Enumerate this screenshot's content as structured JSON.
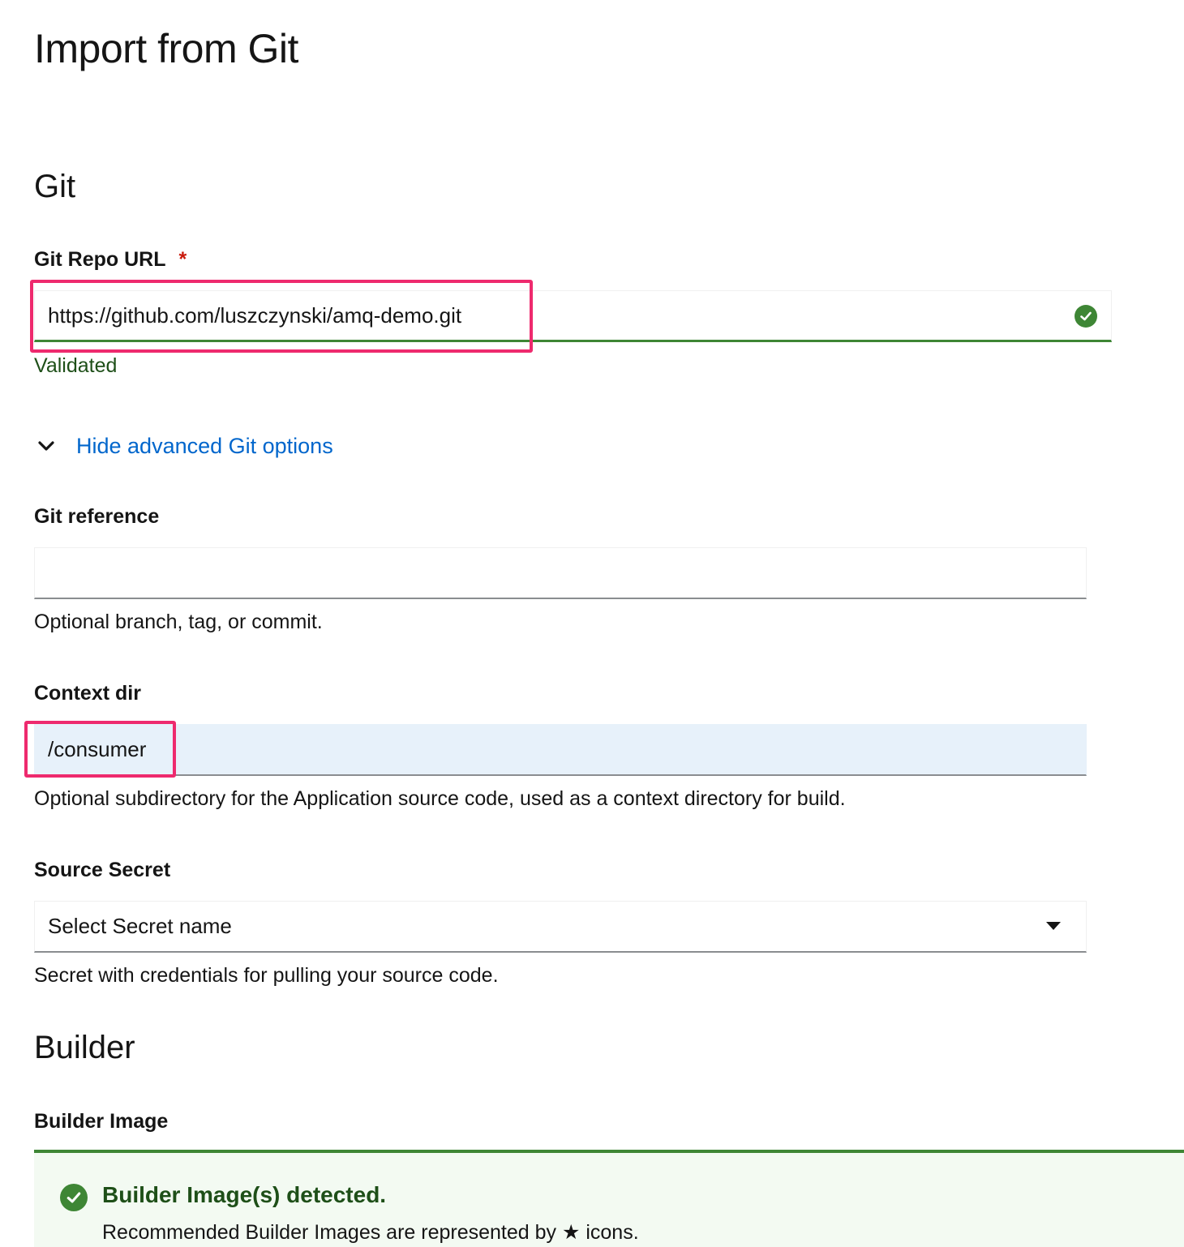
{
  "page": {
    "title": "Import from Git"
  },
  "git": {
    "section_title": "Git",
    "repo_url": {
      "label": "Git Repo URL",
      "required_mark": "*",
      "value": "https://github.com/luszczynski/amq-demo.git",
      "status": "Validated"
    },
    "advanced_toggle": {
      "label": "Hide advanced Git options"
    },
    "reference": {
      "label": "Git reference",
      "value": "",
      "helper": "Optional branch, tag, or commit."
    },
    "context_dir": {
      "label": "Context dir",
      "value": "/consumer",
      "helper": "Optional subdirectory for the Application source code, used as a context directory for build."
    },
    "source_secret": {
      "label": "Source Secret",
      "placeholder": "Select Secret name",
      "helper": "Secret with credentials for pulling your source code."
    }
  },
  "builder": {
    "section_title": "Builder",
    "image_label": "Builder Image",
    "alert": {
      "title": "Builder Image(s) detected.",
      "body": "Recommended Builder Images are represented by ★ icons."
    }
  },
  "colors": {
    "success": "#3e8635",
    "link": "#0066cc",
    "highlight": "#ee2a6e",
    "required": "#c9190b"
  }
}
